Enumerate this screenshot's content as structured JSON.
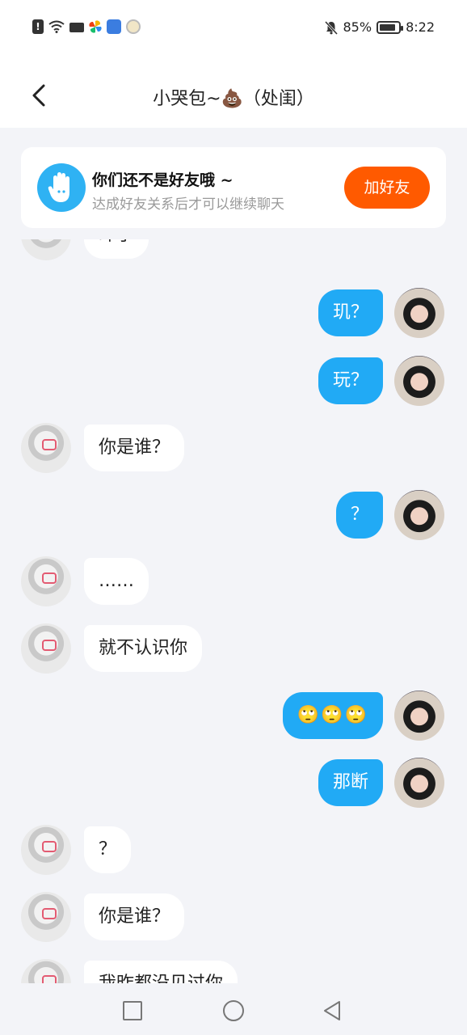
{
  "status_bar": {
    "battery": "85%",
    "battery_level": 0.85,
    "time": "8:22"
  },
  "header": {
    "title": "小哭包~💩（处闺）",
    "back_icon": "chevron-left-icon"
  },
  "friend_card": {
    "title": "你们还不是好友哦 ~",
    "subtitle": "达成好友关系后才可以继续聊天",
    "add_button": "加好友",
    "icon": "hand-icon",
    "accent": "#ff5a00",
    "icon_color": "#2fb2f3"
  },
  "messages": [
    {
      "from": "them",
      "text": "昨了"
    },
    {
      "from": "me",
      "text": "玑？"
    },
    {
      "from": "me",
      "text": "玩？"
    },
    {
      "from": "them",
      "text": "你是谁？"
    },
    {
      "from": "me",
      "text": "？"
    },
    {
      "from": "them",
      "text": "……"
    },
    {
      "from": "them",
      "text": "就不认识你"
    },
    {
      "from": "me",
      "text": "🙄🙄🙄"
    },
    {
      "from": "me",
      "text": "那断"
    },
    {
      "from": "them",
      "text": "？"
    },
    {
      "from": "them",
      "text": "你是谁？"
    },
    {
      "from": "them",
      "text": "我昨都没见过你"
    }
  ],
  "colors": {
    "my_bubble": "#21aaf5",
    "their_bubble": "#ffffff",
    "background": "#f3f4f8"
  },
  "nav": {
    "recent": "square-icon",
    "home": "circle-icon",
    "back": "triangle-back-icon"
  }
}
